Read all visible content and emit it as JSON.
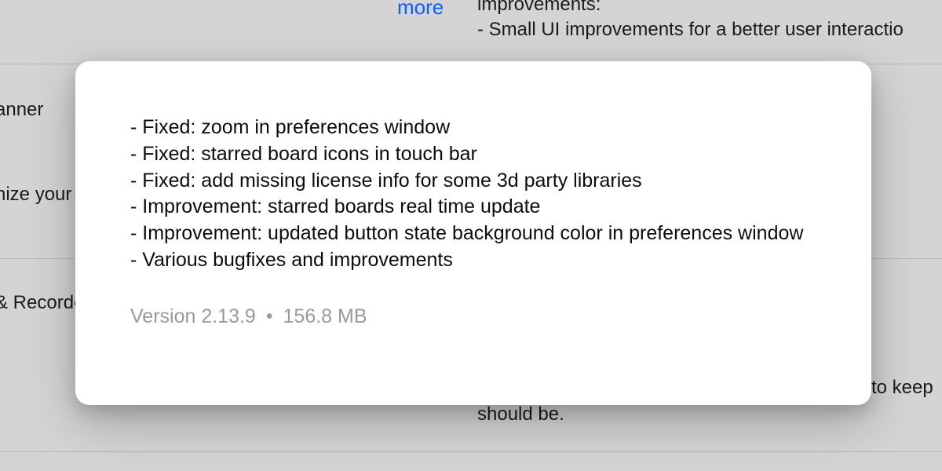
{
  "background": {
    "more_link": "more",
    "top_heading_fragment": "improvements:",
    "top_line_fragment": "- Small UI improvements  for a better user interactio",
    "row2_left_1": "anner",
    "row2_left_2": "nize your",
    "row3_left": "& Recorde",
    "row3_right_1": "to keep",
    "row3_right_2": "should be."
  },
  "popover": {
    "notes": [
      "- Fixed: zoom in preferences window",
      "- Fixed: starred board icons in touch bar",
      "- Fixed: add missing license info for some 3d party libraries",
      "- Improvement: starred boards real time update",
      "- Improvement: updated button state background color in preferences window",
      "- Various bugfixes and improvements"
    ],
    "version_label": "Version 2.13.9",
    "separator": "•",
    "size_label": "156.8 MB"
  }
}
